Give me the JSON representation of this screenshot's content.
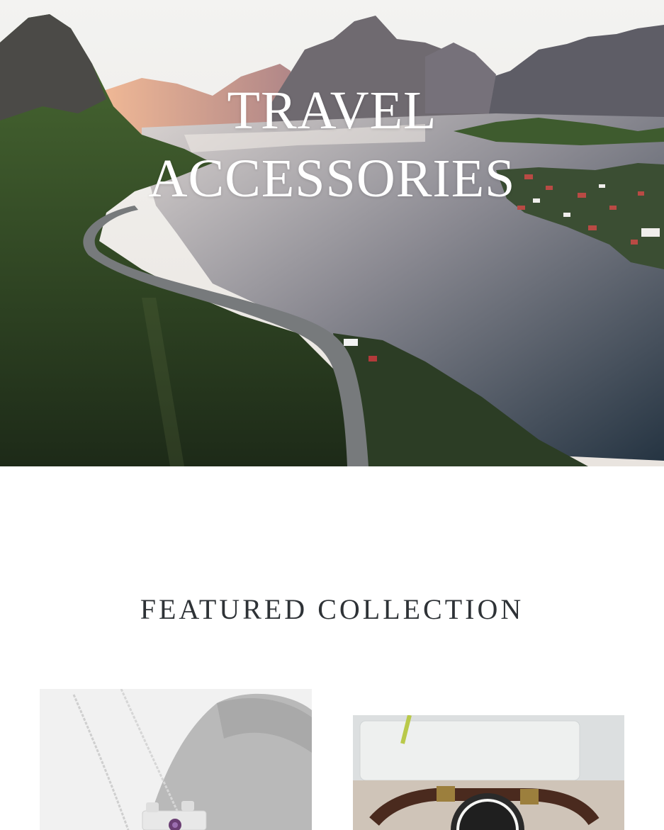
{
  "hero": {
    "title_line1": "TRAVEL",
    "title_line2": "ACCESSORIES",
    "image": "aerial-fjord-landscape"
  },
  "featured": {
    "heading": "FEATURED COLLECTION"
  },
  "products": [
    {
      "image": "silver-camera-pendant-necklace"
    },
    {
      "image": "leather-strap-wristwatch"
    }
  ],
  "colors": {
    "heading_text": "#2e3236",
    "hero_text": "#ffffff",
    "background": "#ffffff"
  }
}
